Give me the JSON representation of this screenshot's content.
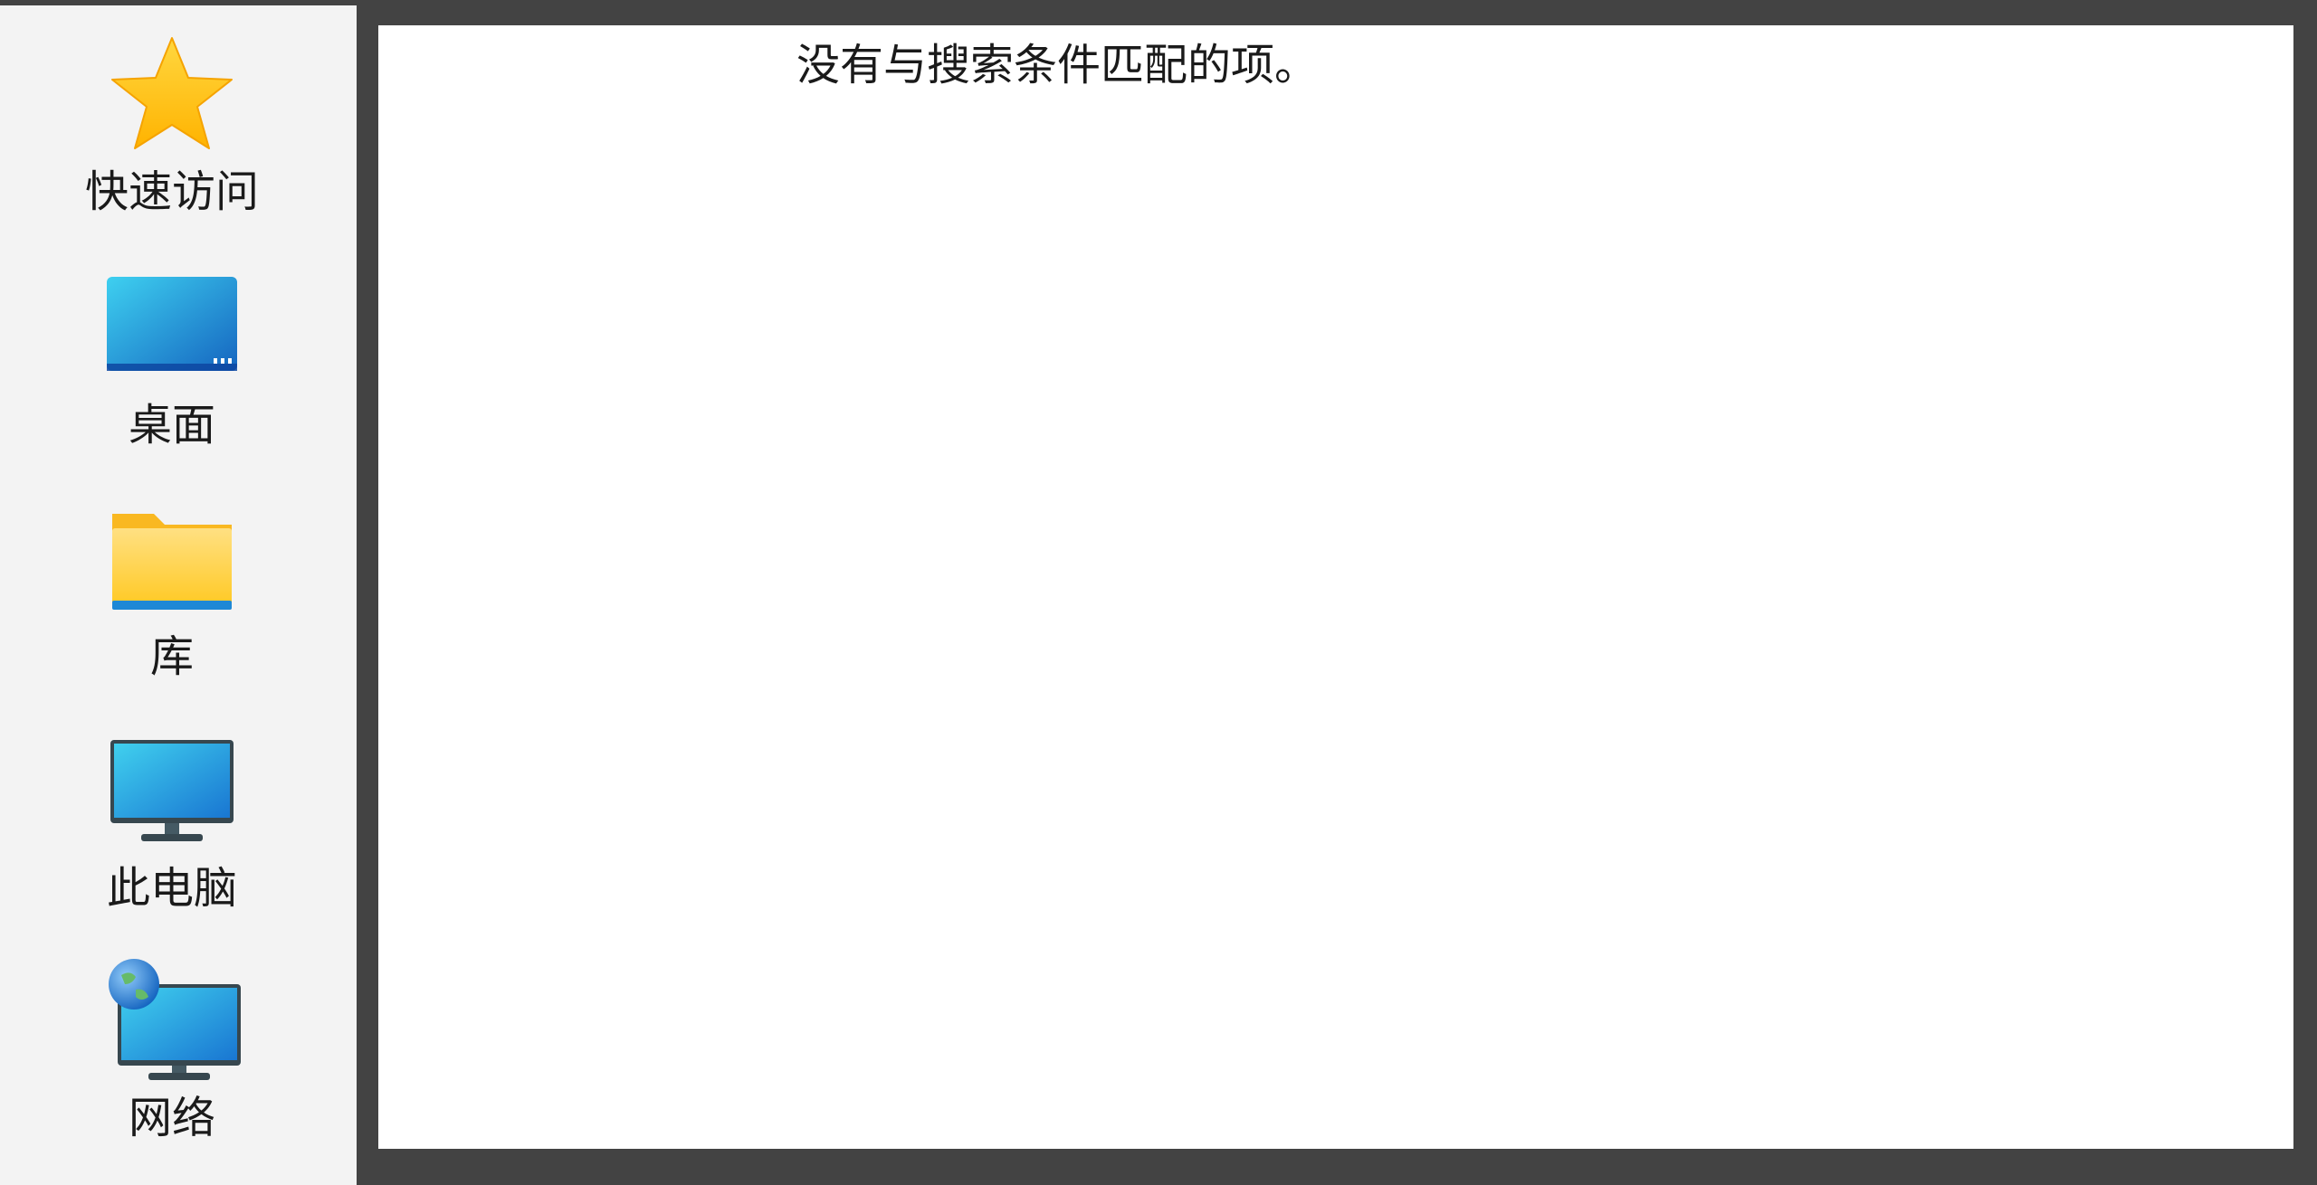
{
  "places": [
    {
      "label": "快速访问",
      "icon": "star-icon"
    },
    {
      "label": "桌面",
      "icon": "desktop-icon"
    },
    {
      "label": "库",
      "icon": "folder-icon"
    },
    {
      "label": "此电脑",
      "icon": "computer-icon"
    },
    {
      "label": "网络",
      "icon": "network-icon"
    }
  ],
  "file_list": {
    "empty_message": "没有与搜索条件匹配的项。"
  },
  "colors": {
    "frame": "#434343",
    "sidebar_bg": "#f3f3f3",
    "list_bg": "#ffffff",
    "star": "#ffc107",
    "accent_blue": "#1e88d6",
    "folder": "#ffd54f"
  }
}
